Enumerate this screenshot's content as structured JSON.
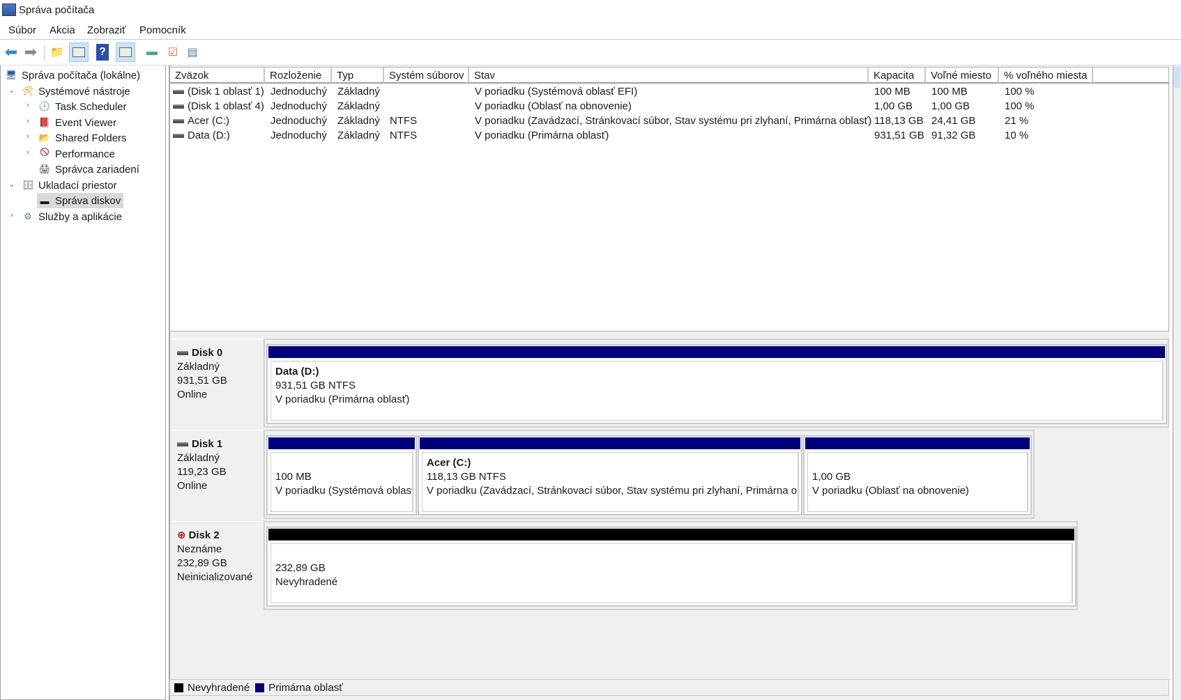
{
  "window": {
    "title": "Správa počítača"
  },
  "menu": [
    "Súbor",
    "Akcia",
    "Zobraziť",
    "Pomocník"
  ],
  "tree": [
    {
      "label": "Správa počítača (lokálne)"
    },
    {
      "label": "Systémové nástroje"
    },
    {
      "label": "Task Scheduler"
    },
    {
      "label": "Event Viewer"
    },
    {
      "label": "Shared Folders"
    },
    {
      "label": "Performance"
    },
    {
      "label": "Správca zariadení"
    },
    {
      "label": "Ukladací priestor"
    },
    {
      "label": "Správa diskov"
    },
    {
      "label": "Služby a aplikácie"
    }
  ],
  "table": {
    "headers": [
      "Zväzok",
      "Rozloženie",
      "Typ",
      "Systém súborov",
      "Stav",
      "Kapacita",
      "Voľné miesto",
      "% voľného miesta"
    ],
    "rows": [
      [
        "(Disk 1 oblasť 1)",
        "Jednoduchý",
        "Základný",
        "",
        "V poriadku (Systémová oblasť EFI)",
        "100 MB",
        "100 MB",
        "100 %"
      ],
      [
        "(Disk 1 oblasť 4)",
        "Jednoduchý",
        "Základný",
        "",
        "V poriadku (Oblasť na obnovenie)",
        "1,00 GB",
        "1,00 GB",
        "100 %"
      ],
      [
        "Acer (C:)",
        "Jednoduchý",
        "Základný",
        "NTFS",
        "V poriadku (Zavádzací, Stránkovací súbor, Stav systému pri zlyhaní, Primárna oblasť)",
        "118,13 GB",
        "24,41 GB",
        "21 %"
      ],
      [
        "Data (D:)",
        "Jednoduchý",
        "Základný",
        "NTFS",
        "V poriadku (Primárna oblasť)",
        "931,51 GB",
        "91,32 GB",
        "10 %"
      ]
    ]
  },
  "disks": [
    {
      "name": "Disk 0",
      "type": "Základný",
      "size": "931,51 GB",
      "status": "Online",
      "partitions": [
        {
          "title": "Data  (D:)",
          "line1": "931,51 GB NTFS",
          "line2": "V poriadku (Primárna oblasť)"
        }
      ]
    },
    {
      "name": "Disk 1",
      "type": "Základný",
      "size": "119,23 GB",
      "status": "Online",
      "partitions": [
        {
          "title": "",
          "line1": "100 MB",
          "line2": "V poriadku (Systémová oblast"
        },
        {
          "title": "Acer  (C:)",
          "line1": "118,13 GB NTFS",
          "line2": "V poriadku (Zavádzací, Stránkovací súbor, Stav systému pri zlyhaní, Primárna obl"
        },
        {
          "title": "",
          "line1": "1,00 GB",
          "line2": "V poriadku (Oblasť na obnovenie)"
        }
      ]
    },
    {
      "name": "Disk 2",
      "type": "Neznáme",
      "size": "232,89 GB",
      "status": "Neinicializované",
      "partitions": [
        {
          "title": "",
          "line1": "232,89 GB",
          "line2": "Nevyhradené"
        }
      ]
    }
  ],
  "legend": [
    {
      "label": "Nevyhradené",
      "color": "#000000"
    },
    {
      "label": "Primárna oblasť",
      "color": "#00007f"
    }
  ],
  "colors": {
    "primary": "#00007f",
    "unallocated": "#000000"
  }
}
